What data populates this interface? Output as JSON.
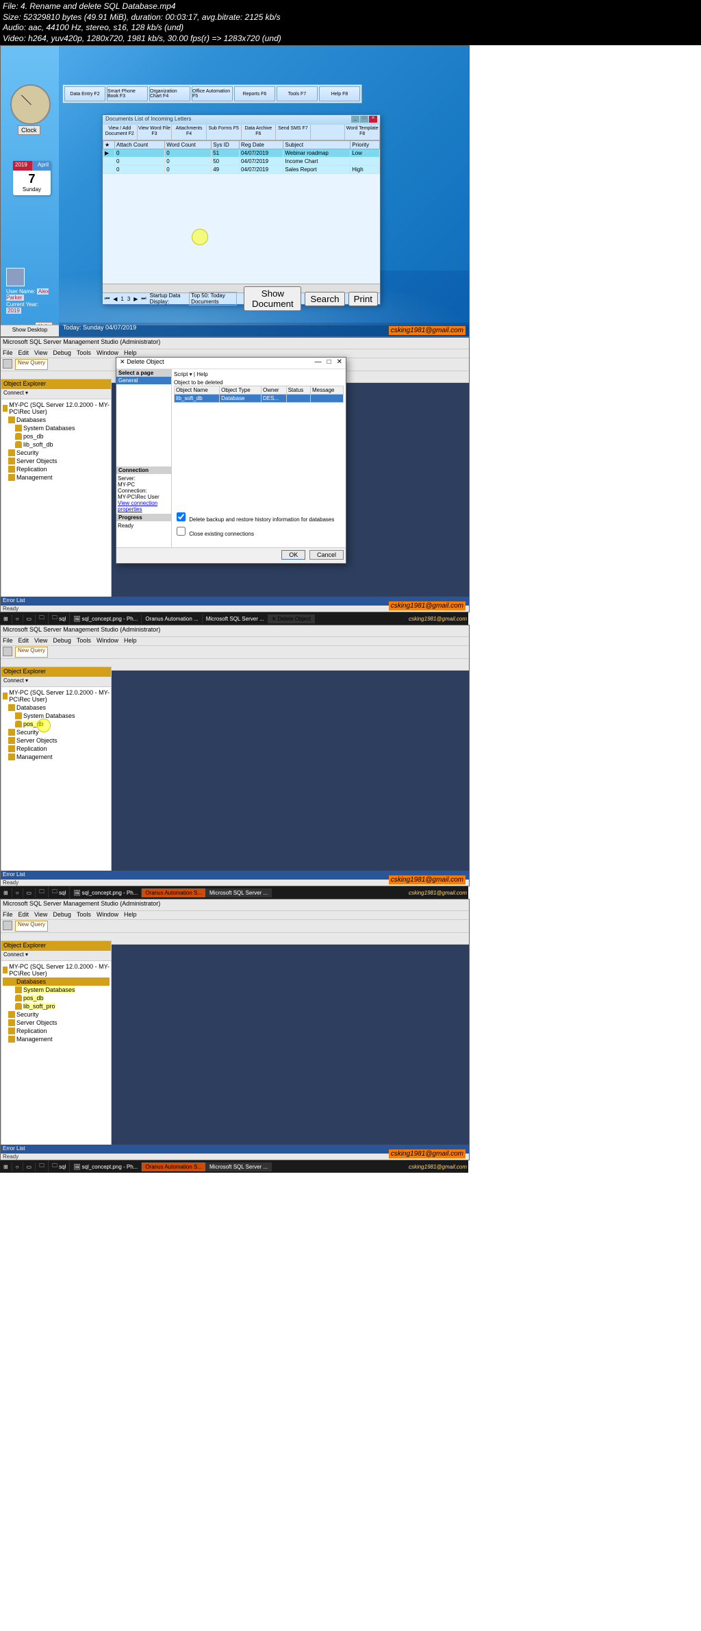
{
  "file_info": {
    "l1": "File: 4. Rename and delete SQL Database.mp4",
    "l2": "Size: 52329810 bytes (49.91 MiB), duration: 00:03:17, avg.bitrate: 2125 kb/s",
    "l3": "Audio: aac, 44100 Hz, stereo, s16, 128 kb/s (und)",
    "l4": "Video: h264, yuv420p, 1280x720, 1981 kb/s, 30.00 fps(r) => 1283x720 (und)"
  },
  "watermark": "csking1981@gmail.com",
  "shot1": {
    "clock_btn": "Clock",
    "cal_year": "2019",
    "cal_month": "April",
    "cal_day": "7",
    "cal_dow": "Sunday",
    "user_label": "User Name:",
    "user_name": "Alex Parker",
    "year_label": "Current Year:",
    "year_val": "2019",
    "help": "Help",
    "show_desktop": "Show Desktop",
    "today": "Today: Sunday 04/07/2019",
    "toolbar": [
      "Data Entry F2",
      "Smart Phone Book F3",
      "Organization Chart F4",
      "Office Automation F5",
      "Reports F6",
      "Tools F7",
      "Help F8"
    ],
    "dw_title": "Documents List of Incoming Letters",
    "dw_bar": [
      "View / Add Document F2",
      "View Word File F3",
      "Attachments F4",
      "Sub Forms F5",
      "Data Archive F6",
      "Send SMS F7",
      "",
      "Word Template F8"
    ],
    "cols": [
      "",
      "Attach Count",
      "Word Count",
      "Sys ID",
      "Reg Date",
      "Subject",
      "Priority"
    ],
    "rows": [
      [
        "▶",
        "0",
        "0",
        "51",
        "04/07/2019",
        "Webinar roadmap",
        "Low"
      ],
      [
        "",
        "0",
        "0",
        "50",
        "04/07/2019",
        "Income Chart",
        ""
      ],
      [
        "",
        "0",
        "0",
        "49",
        "04/07/2019",
        "Sales Report",
        "High"
      ]
    ],
    "foot_pg": "1",
    "foot_of": "3",
    "foot_startup": "Startup Data Display:",
    "foot_startup_v": "Top 50: Today Documents",
    "foot_show": "Show Document",
    "foot_search": "Search",
    "foot_print": "Print"
  },
  "ssms_title": "Microsoft SQL Server Management Studio (Administrator)",
  "ssms_menu": [
    "File",
    "Edit",
    "View",
    "Debug",
    "Tools",
    "Window",
    "Help"
  ],
  "ssms_newquery": "New Query",
  "oe_title": "Object Explorer",
  "oe_connect": "Connect ▾",
  "tree_server": "MY-PC (SQL Server 12.0.2000 - MY-PC\\Rec User)",
  "tree_db": "Databases",
  "tree_sysdb": "System Databases",
  "tree_pos": "pos_db",
  "tree_lib": "lib_soft_db",
  "tree_lib2": "lib_soft_pro",
  "tree_sec": "Security",
  "tree_srvobj": "Server Objects",
  "tree_repl": "Replication",
  "tree_mgmt": "Management",
  "errlist": "Error List",
  "ready": "Ready",
  "dialog": {
    "title": "Delete Object",
    "select_pg": "Select a page",
    "general": "General",
    "connection_h": "Connection",
    "server_l": "Server:",
    "server_v": "MY-PC",
    "conn_l": "Connection:",
    "conn_v": "MY-PC\\Rec User",
    "view_conn": "View connection properties",
    "progress": "Progress",
    "ready": "Ready",
    "script": "Script",
    "help": "Help",
    "obj_del": "Object to be deleted",
    "cols": [
      "Object Name",
      "Object Type",
      "Owner",
      "Status",
      "Message"
    ],
    "row": [
      "lib_soft_db",
      "Database",
      "DES...",
      "",
      ""
    ],
    "chk1": "Delete backup and restore history information for databases",
    "chk2": "Close existing connections",
    "ok": "OK",
    "cancel": "Cancel"
  },
  "taskbar": {
    "sql": "sql",
    "concept": "sql_concept.png - Ph...",
    "oranus_full": "Oranus Automation S...",
    "oranus_short": "Oranus Automation ...",
    "ssms": "Microsoft SQL Server ...",
    "delobj": "Delete Object"
  }
}
